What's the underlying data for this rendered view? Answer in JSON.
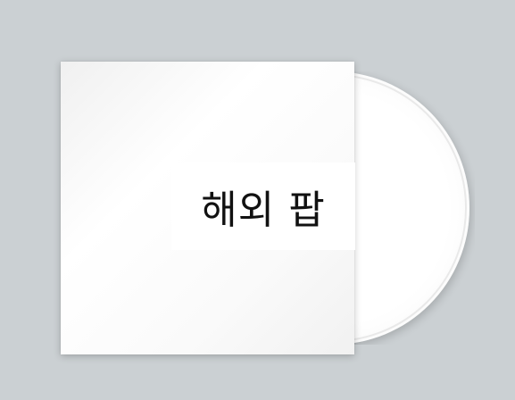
{
  "album": {
    "title": "해외 팝"
  },
  "colors": {
    "background": "#cbd0d3",
    "sleeve": "#ffffff",
    "disc": "#ffffff",
    "text": "#111111"
  },
  "icons": [
    "cd-disc-icon",
    "album-sleeve"
  ]
}
